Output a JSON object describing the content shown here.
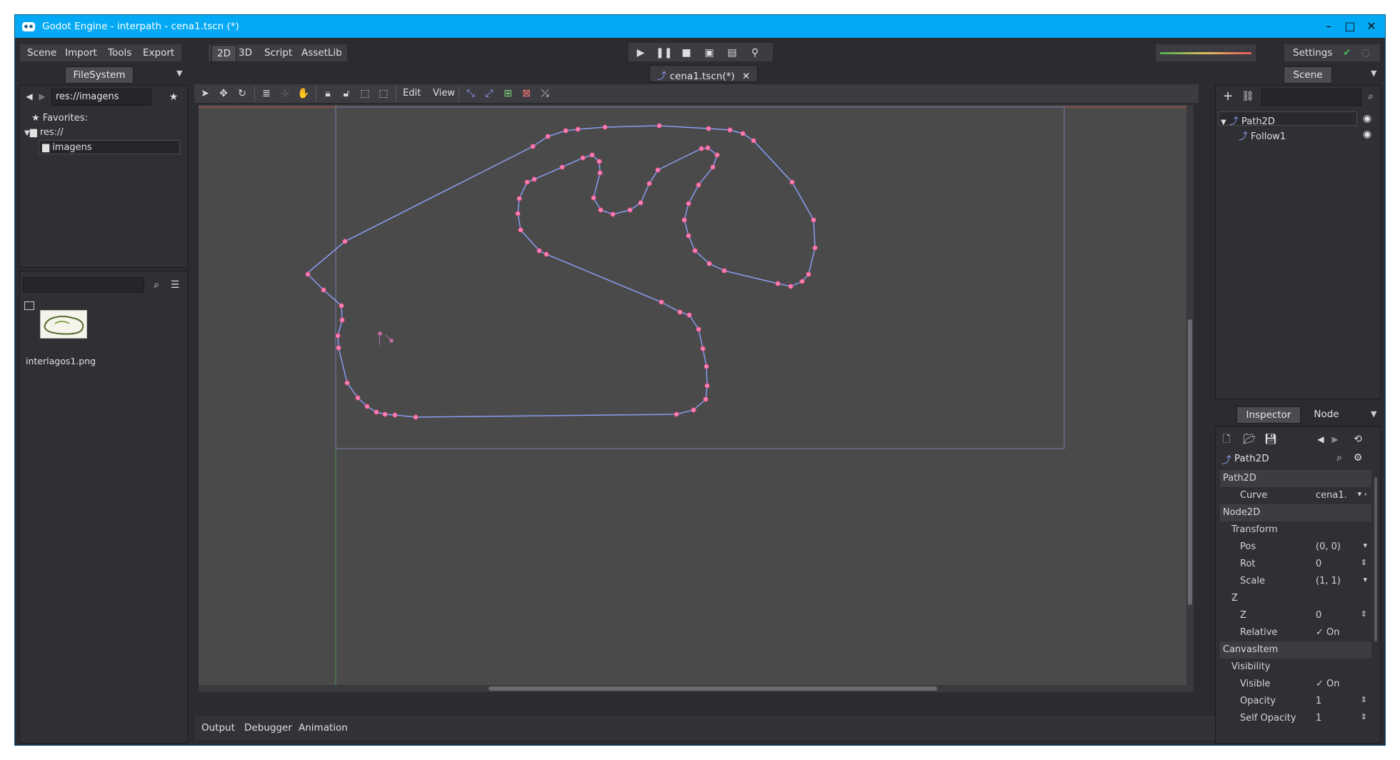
{
  "window": {
    "title": "Godot Engine - interpath - cena1.tscn (*)"
  },
  "main_menu": [
    "Scene",
    "Import",
    "Tools",
    "Export"
  ],
  "workspace_tabs": [
    "2D",
    "3D",
    "Script",
    "AssetLib"
  ],
  "settings_label": "Settings",
  "filesystem": {
    "tab": "FileSystem",
    "path": "res://imagens",
    "favorites": "Favorites:",
    "root": "res://",
    "folder": "imagens",
    "file_name": "interlagos1.png"
  },
  "editor_tab": "cena1.tscn(*)",
  "toolbar_menus": [
    "Edit",
    "View"
  ],
  "scene": {
    "tab": "Scene",
    "nodes": [
      "Path2D",
      "Follow1"
    ]
  },
  "inspector": {
    "tabs": [
      "Inspector",
      "Node"
    ],
    "node_name": "Path2D",
    "rows": [
      {
        "type": "section",
        "label": "Path2D"
      },
      {
        "type": "prop",
        "label": "Curve",
        "value": "cena1.",
        "indent": 2
      },
      {
        "type": "section",
        "label": "Node2D"
      },
      {
        "type": "group",
        "label": "Transform",
        "indent": 1
      },
      {
        "type": "prop",
        "label": "Pos",
        "value": "(0, 0)",
        "indent": 2
      },
      {
        "type": "prop",
        "label": "Rot",
        "value": "0",
        "indent": 2
      },
      {
        "type": "prop",
        "label": "Scale",
        "value": "(1, 1)",
        "indent": 2
      },
      {
        "type": "group",
        "label": "Z",
        "indent": 1
      },
      {
        "type": "prop",
        "label": "Z",
        "value": "0",
        "indent": 2
      },
      {
        "type": "prop",
        "label": "Relative",
        "value": "✓ On",
        "indent": 2
      },
      {
        "type": "section",
        "label": "CanvasItem"
      },
      {
        "type": "group",
        "label": "Visibility",
        "indent": 1
      },
      {
        "type": "prop",
        "label": "Visible",
        "value": "✓ On",
        "indent": 2
      },
      {
        "type": "prop",
        "label": "Opacity",
        "value": "1",
        "indent": 2
      },
      {
        "type": "prop",
        "label": "Self Opacity",
        "value": "1",
        "indent": 2
      }
    ]
  },
  "bottom_tabs": [
    "Output",
    "Debugger",
    "Animation"
  ],
  "colors": {
    "accent": "#03a9f4",
    "curve": "#8a9cf0",
    "point": "#ff7fb0",
    "guide_x": "#c0504d",
    "guide_y": "#4caf50"
  }
}
